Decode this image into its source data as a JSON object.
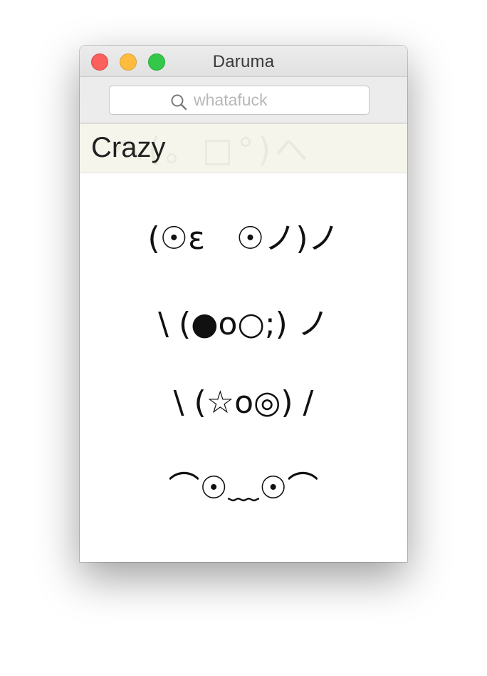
{
  "window": {
    "title": "Daruma"
  },
  "search": {
    "placeholder": "whatafuck",
    "value": ""
  },
  "category": {
    "title": "Crazy",
    "background_emoticon": "へ(。□°)へ"
  },
  "emoticons": [
    "(☉ε　☉ノ)ノ",
    "\\ (●o○;) ノ",
    "\\ (☆o◎) /",
    "⌒☉﹏☉⌒"
  ],
  "colors": {
    "close": "#fc605c",
    "minimize": "#fdbc40",
    "zoom": "#34c84a",
    "category_bg": "#f6f5ec"
  }
}
